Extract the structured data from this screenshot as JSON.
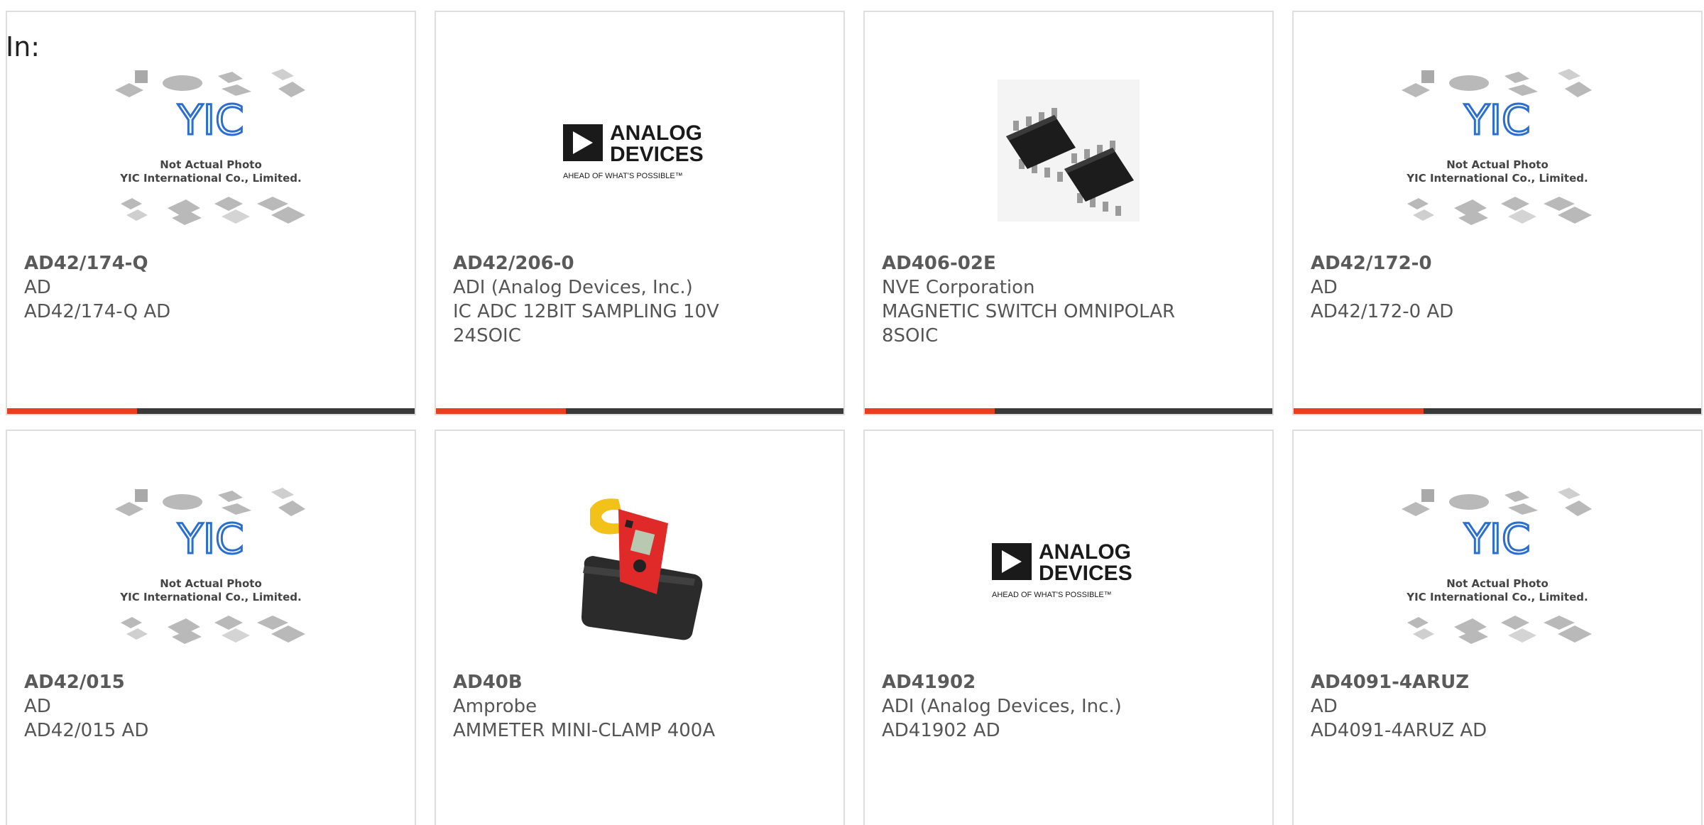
{
  "header": {
    "in_label": "In:"
  },
  "placeholder_image": {
    "line1": "Not Actual Photo",
    "line2": "YIC International Co., Limited.",
    "logo_text": "YIC"
  },
  "adi_logo": {
    "line1": "ANALOG",
    "line2": "DEVICES",
    "tagline": "AHEAD OF WHAT'S POSSIBLE™"
  },
  "colors": {
    "accent": "#e8401c",
    "bar_dark": "#3a3a3a",
    "yic_blue": "#2a6fd0",
    "text": "#555555"
  },
  "products": [
    {
      "part_number": "AD42/174-Q",
      "manufacturer": "AD",
      "description": "AD42/174-Q AD",
      "image": "yic-placeholder"
    },
    {
      "part_number": "AD42/206-0",
      "manufacturer": "ADI (Analog Devices, Inc.)",
      "description": "IC ADC 12BIT SAMPLING 10V 24SOIC",
      "image": "analog-devices-logo"
    },
    {
      "part_number": "AD406-02E",
      "manufacturer": "NVE Corporation",
      "description": "MAGNETIC SWITCH OMNIPOLAR 8SOIC",
      "image": "soic-chip-photo"
    },
    {
      "part_number": "AD42/172-0",
      "manufacturer": "AD",
      "description": "AD42/172-0 AD",
      "image": "yic-placeholder"
    },
    {
      "part_number": "AD42/015",
      "manufacturer": "AD",
      "description": "AD42/015 AD",
      "image": "yic-placeholder"
    },
    {
      "part_number": "AD40B",
      "manufacturer": "Amprobe",
      "description": "AMMETER MINI-CLAMP 400A",
      "image": "clamp-meter-photo"
    },
    {
      "part_number": "AD41902",
      "manufacturer": "ADI (Analog Devices, Inc.)",
      "description": "AD41902 AD",
      "image": "analog-devices-logo"
    },
    {
      "part_number": "AD4091-4ARUZ",
      "manufacturer": "AD",
      "description": "AD4091-4ARUZ AD",
      "image": "yic-placeholder"
    }
  ]
}
